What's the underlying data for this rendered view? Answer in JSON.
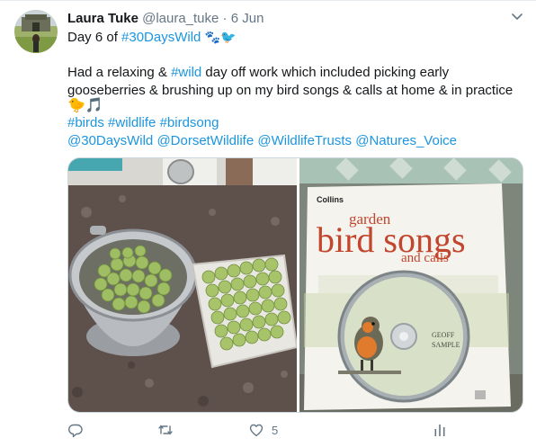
{
  "tweet": {
    "display_name": "Laura Tuke",
    "handle": "@laura_tuke",
    "separator": "·",
    "date": "6 Jun",
    "day_prefix": "Day 6 of ",
    "day_hashtag": "#30DaysWild",
    "day_emoji": "🐾🐦",
    "line1_pre": "Had a relaxing & ",
    "line1_hashtag": "#wild",
    "line1_post": " day off work which included picking early",
    "line2": "gooseberries & brushing up on my bird songs & calls at home & in practice",
    "line3_emoji": "🐤🎵",
    "hashtags": [
      "#birds",
      "#wildlife",
      "#birdsong"
    ],
    "mentions": [
      "@30DaysWild",
      "@DorsetWildlife",
      "@WildlifeTrusts",
      "@Natures_Voice"
    ]
  },
  "book": {
    "publisher": "Collins",
    "subtitle_top": "garden",
    "title": "bird songs",
    "subtitle_bottom": "and calls",
    "author_first": "GEOFF",
    "author_last": "SAMPLE"
  },
  "actions": {
    "reply_count": "",
    "retweet_count": "",
    "like_count": "5"
  },
  "colors": {
    "link": "#1b95e0",
    "muted": "#657786",
    "book_title": "#c2452d"
  },
  "icons": {
    "reply": "reply-icon",
    "retweet": "retweet-icon",
    "like": "heart-icon",
    "stats": "bar-chart-icon",
    "menu": "chevron-down-icon"
  }
}
